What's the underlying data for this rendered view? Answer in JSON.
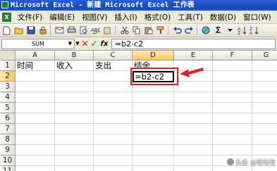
{
  "window": {
    "title": "Microsoft Excel - 新建 Microsoft Excel 工作表"
  },
  "menu": {
    "items": [
      {
        "label": "文件(F)"
      },
      {
        "label": "编辑(E)"
      },
      {
        "label": "视图(V)"
      },
      {
        "label": "插入(I)"
      },
      {
        "label": "格式(O)"
      },
      {
        "label": "工具(T)"
      },
      {
        "label": "数据(D)"
      },
      {
        "label": "窗口(W)"
      },
      {
        "label": "帮"
      }
    ]
  },
  "toolbar": {
    "icons": [
      "new-icon",
      "open-icon",
      "save-icon",
      "permission-icon",
      "email-icon",
      "print-icon",
      "print-preview-icon",
      "spelling-icon",
      "research-icon",
      "cut-icon",
      "copy-icon",
      "paste-icon",
      "format-painter-icon",
      "undo-icon",
      "redo-icon",
      "hyperlink-icon",
      "autosum-icon",
      "sort-ascending-icon",
      "sort-descending-icon"
    ],
    "autosum_symbol": "Σ"
  },
  "formula_bar": {
    "name_box": "SUM",
    "cancel_symbol": "✕",
    "enter_symbol": "✓",
    "fx_label": "fx",
    "formula": "=b2-c2"
  },
  "sheet": {
    "columns": [
      "A",
      "B",
      "C",
      "D",
      "E",
      "F",
      "G"
    ],
    "active_column": "D",
    "rows": [
      "1",
      "2",
      "3",
      "4",
      "5",
      "6",
      "7",
      "8",
      "9",
      "10",
      "11"
    ],
    "active_row": "2",
    "cells": {
      "A1": "时间",
      "B1": "收入",
      "C1": "支出",
      "D1": "结余",
      "D2": "=b2-c2"
    },
    "highlight_color": "#e02020"
  },
  "watermark": {
    "text": "头条 @哈哈有"
  }
}
